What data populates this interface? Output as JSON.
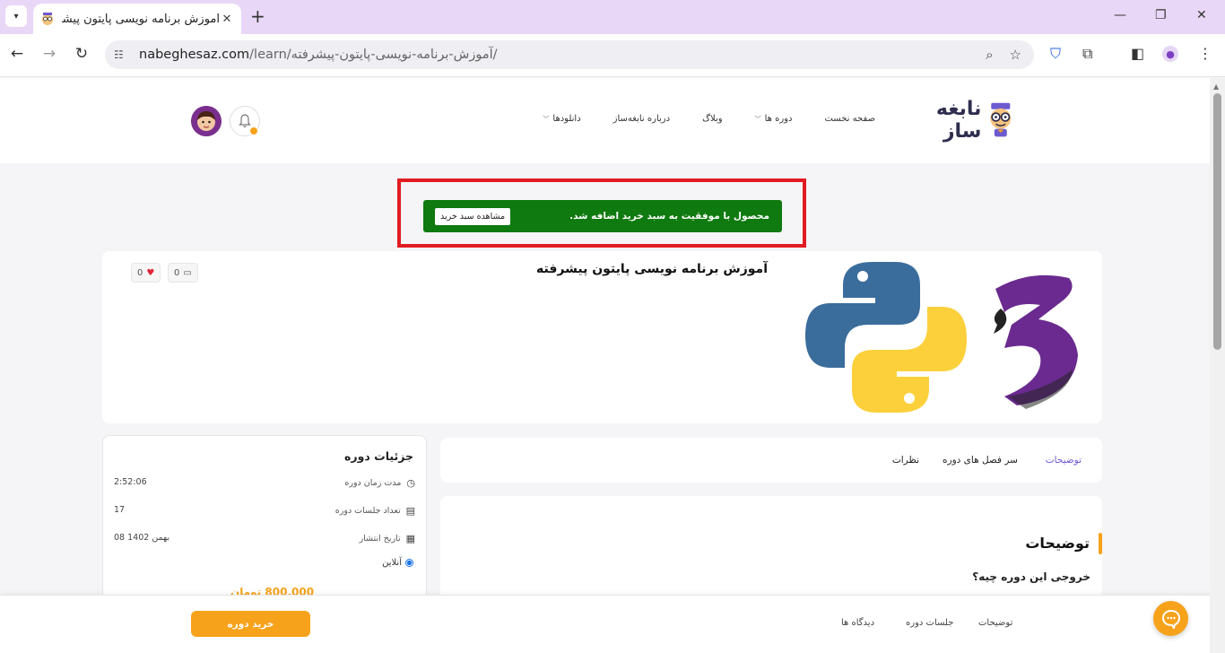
{
  "browser": {
    "tab_title": "آموزش برنامه نویسی پایتون پیشرفته",
    "url_host": "nabeghesaz.com",
    "url_path": "/learn/آموزش-برنامه-نویسی-پایتون-پیشرفته/"
  },
  "header": {
    "logo_text": "نابغه ساز",
    "menu": [
      {
        "label": "صفحه نخست",
        "dropdown": false
      },
      {
        "label": "دوره ها",
        "dropdown": true
      },
      {
        "label": "وبلاگ",
        "dropdown": false
      },
      {
        "label": "درباره نابغه‌ساز",
        "dropdown": false
      },
      {
        "label": "دانلودها",
        "dropdown": true
      }
    ],
    "notification_count": "0"
  },
  "alert": {
    "message": "محصول با موفقیت به سبد خرید اضافه شد.",
    "button_label": "مشاهده سبد خرید"
  },
  "course": {
    "title": "آموزش برنامه نویسی پایتون پیشرفته",
    "comments_count": "0",
    "likes_count": "0"
  },
  "tabs": [
    "توضیحات",
    "سر فصل های دوره",
    "نظرات"
  ],
  "description": {
    "title": "توضیحات",
    "subtitle": "خروجی این دوره چیه؟"
  },
  "details": {
    "title": "جزئیات دوره",
    "rows": [
      {
        "label": "مدت زمان دوره",
        "value": "2:52:06",
        "icon": "clock-icon"
      },
      {
        "label": "تعداد جلسات دوره",
        "value": "17",
        "icon": "book-icon"
      },
      {
        "label": "تاریخ انتشار",
        "value": "08 بهمن 1402",
        "icon": "calendar-icon"
      }
    ],
    "mode": "آنلاین",
    "price": "800,000 تومان"
  },
  "bottom_bar": {
    "buy_label": "خرید دوره",
    "links": [
      "توضیحات",
      "جلسات دوره",
      "دیدگاه ها"
    ]
  },
  "colors": {
    "accent": "#f7a21b",
    "alert_green": "#0f7a0f",
    "highlight_red": "#e11b22",
    "tab_active": "#6b5bd6"
  }
}
